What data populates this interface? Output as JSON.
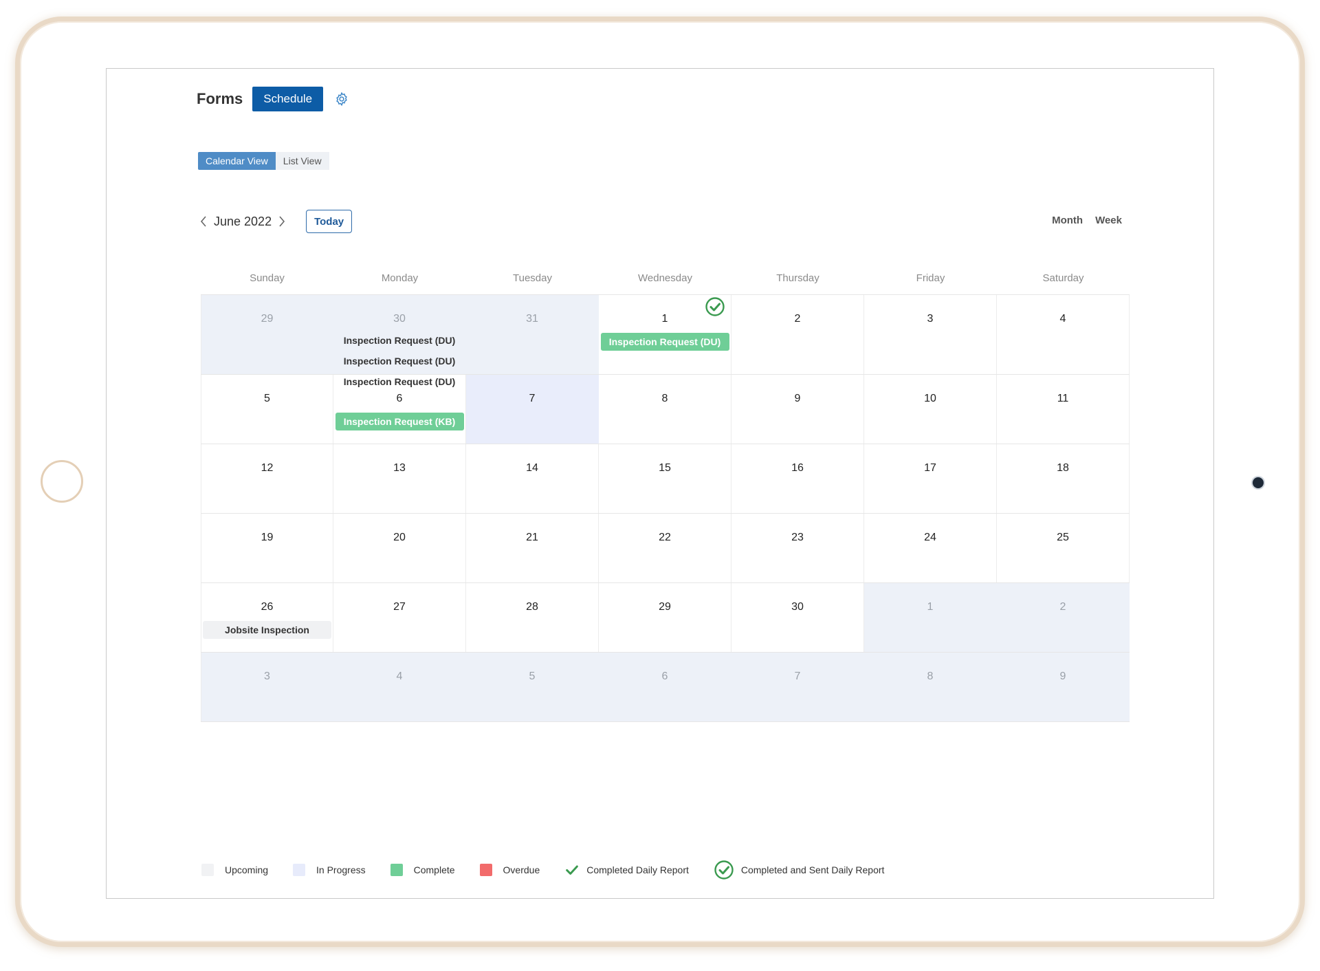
{
  "header": {
    "title": "Forms",
    "schedule_label": "Schedule"
  },
  "views": {
    "calendar_label": "Calendar View",
    "list_label": "List View"
  },
  "nav": {
    "month_label": "June 2022",
    "today_label": "Today",
    "month_mode": "Month",
    "week_mode": "Week"
  },
  "calendar": {
    "days_of_week": [
      "Sunday",
      "Monday",
      "Tuesday",
      "Wednesday",
      "Thursday",
      "Friday",
      "Saturday"
    ],
    "weeks": [
      [
        {
          "num": "29",
          "state": "other"
        },
        {
          "num": "30",
          "state": "other",
          "events": [
            {
              "label": "Inspection Request (DU)",
              "style": "plain"
            },
            {
              "label": "Inspection Request (DU)",
              "style": "plain"
            },
            {
              "label": "Inspection Request (DU)",
              "style": "plain"
            }
          ]
        },
        {
          "num": "31",
          "state": "other"
        },
        {
          "num": "1",
          "state": "current",
          "sent_check": true,
          "events": [
            {
              "label": "Inspection Request (DU)",
              "style": "green"
            }
          ]
        },
        {
          "num": "2",
          "state": "current"
        },
        {
          "num": "3",
          "state": "current"
        },
        {
          "num": "4",
          "state": "current"
        }
      ],
      [
        {
          "num": "5",
          "state": "current"
        },
        {
          "num": "6",
          "state": "current",
          "events": [
            {
              "label": "Inspection Request (KB)",
              "style": "green"
            }
          ]
        },
        {
          "num": "7",
          "state": "inprogress"
        },
        {
          "num": "8",
          "state": "current"
        },
        {
          "num": "9",
          "state": "current"
        },
        {
          "num": "10",
          "state": "current"
        },
        {
          "num": "11",
          "state": "current"
        }
      ],
      [
        {
          "num": "12",
          "state": "current"
        },
        {
          "num": "13",
          "state": "current"
        },
        {
          "num": "14",
          "state": "current"
        },
        {
          "num": "15",
          "state": "current"
        },
        {
          "num": "16",
          "state": "current"
        },
        {
          "num": "17",
          "state": "current"
        },
        {
          "num": "18",
          "state": "current"
        }
      ],
      [
        {
          "num": "19",
          "state": "current"
        },
        {
          "num": "20",
          "state": "current"
        },
        {
          "num": "21",
          "state": "current"
        },
        {
          "num": "22",
          "state": "current"
        },
        {
          "num": "23",
          "state": "current"
        },
        {
          "num": "24",
          "state": "current"
        },
        {
          "num": "25",
          "state": "current"
        }
      ],
      [
        {
          "num": "26",
          "state": "current",
          "events": [
            {
              "label": "Jobsite Inspection",
              "style": "grey"
            }
          ]
        },
        {
          "num": "27",
          "state": "current"
        },
        {
          "num": "28",
          "state": "current"
        },
        {
          "num": "29",
          "state": "current"
        },
        {
          "num": "30",
          "state": "current"
        },
        {
          "num": "1",
          "state": "other"
        },
        {
          "num": "2",
          "state": "other"
        }
      ],
      [
        {
          "num": "3",
          "state": "other"
        },
        {
          "num": "4",
          "state": "other"
        },
        {
          "num": "5",
          "state": "other"
        },
        {
          "num": "6",
          "state": "other"
        },
        {
          "num": "7",
          "state": "other"
        },
        {
          "num": "8",
          "state": "other"
        },
        {
          "num": "9",
          "state": "other"
        }
      ]
    ]
  },
  "legend": [
    {
      "label": "Upcoming",
      "kind": "swatch",
      "color": "#f1f2f4"
    },
    {
      "label": "In Progress",
      "kind": "swatch",
      "color": "#e7ebfb"
    },
    {
      "label": "Complete",
      "kind": "swatch",
      "color": "#6fce97"
    },
    {
      "label": "Overdue",
      "kind": "swatch",
      "color": "#f26b6b"
    },
    {
      "label": "Completed Daily Report",
      "kind": "check-icon",
      "color": "#3a9a4f"
    },
    {
      "label": "Completed and Sent Daily Report",
      "kind": "circle-check-icon",
      "color": "#3a9a4f"
    }
  ],
  "colors": {
    "accent": "#0d5ca6",
    "calendar_view_active": "#4f8cc6",
    "complete": "#6fce97"
  }
}
